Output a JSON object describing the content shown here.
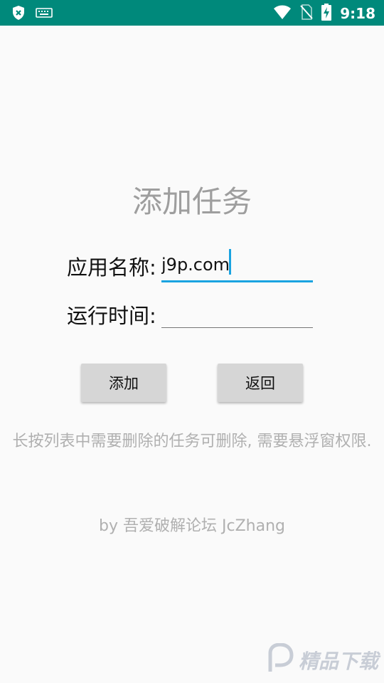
{
  "status_bar": {
    "time": "9:18",
    "left_icons": [
      "shield-icon",
      "keyboard-icon"
    ],
    "right_icons": [
      "wifi-icon",
      "no-sim-icon",
      "battery-charging-icon"
    ]
  },
  "page": {
    "title": "添加任务"
  },
  "form": {
    "app_name_label": "应用名称:",
    "app_name_value": "j9p.com",
    "run_time_label": "运行时间:",
    "run_time_value": ""
  },
  "buttons": {
    "add_label": "添加",
    "back_label": "返回"
  },
  "hint": {
    "text": "长按列表中需要删除的任务可删除, 需要悬浮窗权限."
  },
  "credit": {
    "text": "by 吾爱破解论坛 JcZhang"
  },
  "watermark": {
    "text": "精品下载"
  },
  "colors": {
    "status_bar": "#00897b",
    "accent": "#1aa3e0",
    "button": "#d6d6d6"
  }
}
